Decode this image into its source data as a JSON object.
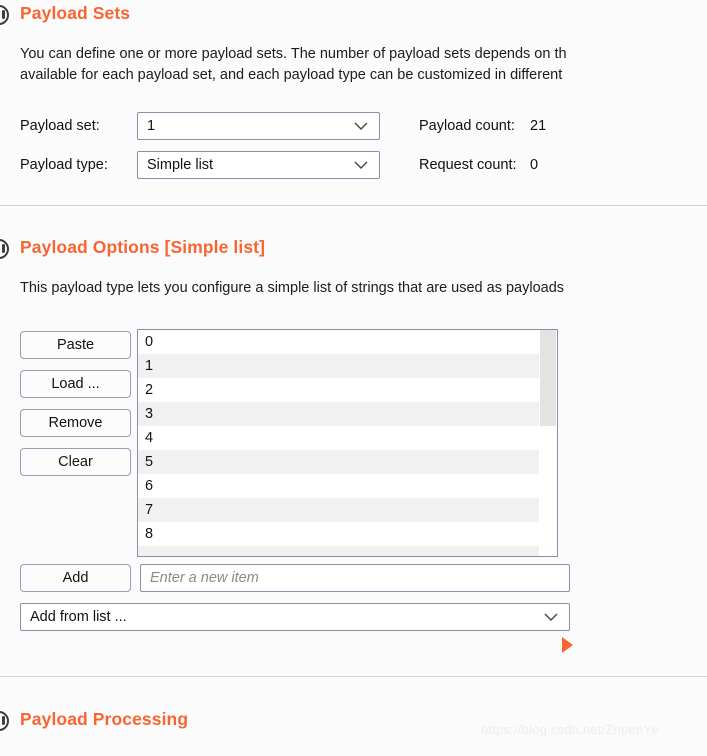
{
  "window": {
    "background": "#fbfbfb",
    "accent_color": "#fa6432",
    "watermark": "https://blog.csdn.net/ZripenYe"
  },
  "payload_sets": {
    "title": "Payload Sets",
    "help_icon": "question-circle-icon",
    "description_line1": "You can define one or more payload sets. The number of payload sets depends on th",
    "description_line2": "available for each payload set, and each payload type can be customized in different",
    "fields": {
      "payload_set_label": "Payload set:",
      "payload_set_value": "1",
      "payload_type_label": "Payload type:",
      "payload_type_value": "Simple list",
      "payload_count_label": "Payload count:",
      "payload_count_value": "21",
      "request_count_label": "Request count:",
      "request_count_value": "0"
    }
  },
  "payload_options": {
    "title": "Payload Options [Simple list]",
    "help_icon": "question-circle-icon",
    "description": "This payload type lets you configure a simple list of strings that are used as payloads",
    "buttons": [
      {
        "label": "Paste",
        "name": "paste-button"
      },
      {
        "label": "Load ...",
        "name": "load-button"
      },
      {
        "label": "Remove",
        "name": "remove-button"
      },
      {
        "label": "Clear",
        "name": "clear-button"
      }
    ],
    "list_items": [
      "0",
      "1",
      "2",
      "3",
      "4",
      "5",
      "6",
      "7",
      "8"
    ],
    "scrollbar": {
      "thumb_top_pct": 0,
      "thumb_height_pct": 43
    },
    "marker_icon": "orange-right-triangle-icon",
    "add_button_label": "Add",
    "new_item_placeholder": "Enter a new item",
    "new_item_value": "",
    "add_from_list_label": "Add from list ..."
  },
  "payload_processing": {
    "title": "Payload Processing",
    "help_icon": "question-circle-icon"
  }
}
